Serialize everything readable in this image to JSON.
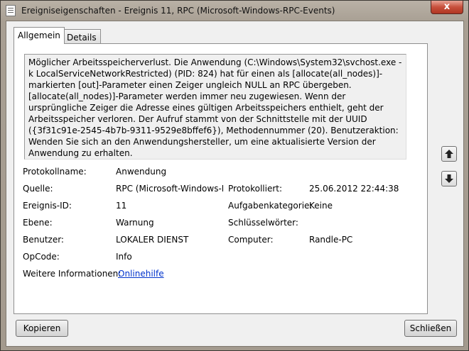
{
  "window": {
    "title": "Ereigniseigenschaften - Ereignis 11, RPC (Microsoft-Windows-RPC-Events)",
    "close_label": "x"
  },
  "tabs": [
    {
      "label": "Allgemein",
      "active": true
    },
    {
      "label": "Details",
      "active": false
    }
  ],
  "description": "Möglicher Arbeitsspeicherverlust.  Die Anwendung (C:\\Windows\\System32\\svchost.exe -k LocalServiceNetworkRestricted) (PID: 824) hat für einen als [allocate(all_nodes)]-markierten [out]-Parameter einen Zeiger ungleich NULL an RPC übergeben. [allocate(all_nodes)]-Parameter werden immer neu zugewiesen. Wenn der ursprüngliche Zeiger die Adresse eines gültigen Arbeitsspeichers enthielt, geht der Arbeitsspeicher verloren. Der Aufruf stammt von der Schnittstelle mit der UUID ({3f31c91e-2545-4b7b-9311-9529e8bffef6}), Methodennummer (20).  Benutzeraktion: Wenden Sie sich an den Anwendungshersteller, um eine aktualisierte Version der Anwendung zu erhalten.",
  "fields": {
    "protokollname": {
      "label": "Protokollname:",
      "value": "Anwendung"
    },
    "quelle": {
      "label": "Quelle:",
      "value": "RPC (Microsoft-Windows-RI"
    },
    "protokolliert": {
      "label": "Protokolliert:",
      "value": "25.06.2012 22:44:38"
    },
    "ereignis_id": {
      "label": "Ereignis-ID:",
      "value": "11"
    },
    "aufgabenkategorie": {
      "label": "Aufgabenkategorie:",
      "value": "Keine"
    },
    "ebene": {
      "label": "Ebene:",
      "value": "Warnung"
    },
    "schluesselwoerter": {
      "label": "Schlüsselwörter:",
      "value": ""
    },
    "benutzer": {
      "label": "Benutzer:",
      "value": "LOKALER DIENST"
    },
    "computer": {
      "label": "Computer:",
      "value": "Randle-PC"
    },
    "opcode": {
      "label": "OpCode:",
      "value": "Info"
    },
    "weitere": {
      "label": "Weitere Informationen:",
      "link": "Onlinehilfe"
    }
  },
  "nav": {
    "up_icon": "arrow-up-icon",
    "down_icon": "arrow-down-icon"
  },
  "buttons": {
    "copy": "Kopieren",
    "close": "Schließen"
  }
}
